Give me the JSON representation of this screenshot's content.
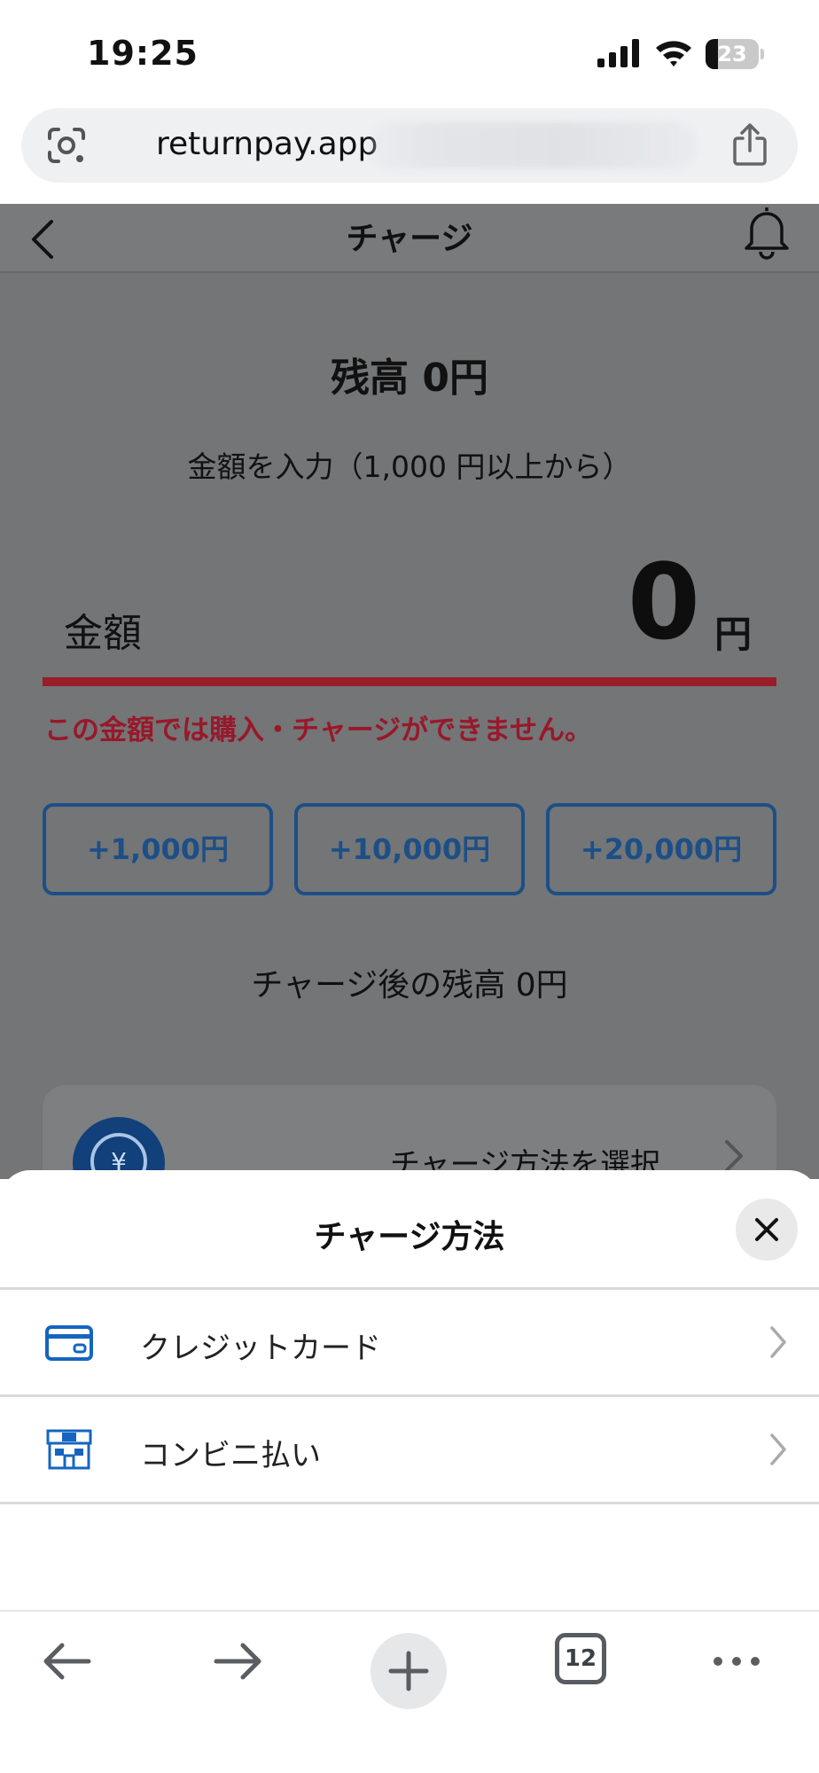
{
  "status_bar": {
    "time": "19:25",
    "battery_percent": 23
  },
  "browser": {
    "url": "returnpay.app"
  },
  "page": {
    "title": "チャージ",
    "balance": "残高 0円",
    "amount_hint": "金額を入力（1,000 円以上から）",
    "amount_label": "金額",
    "amount_value": "0",
    "amount_unit": "円",
    "error": "この金額では購入・チャージができません。",
    "quick_buttons": [
      "+1,000円",
      "+10,000円",
      "+20,000円"
    ],
    "after_balance": "チャージ後の残高 0円",
    "method_select": "チャージ方法を選択"
  },
  "sheet": {
    "title": "チャージ方法",
    "options": [
      {
        "label": "クレジットカード",
        "icon": "credit-card-icon"
      },
      {
        "label": "コンビニ払い",
        "icon": "convenience-store-icon"
      }
    ]
  },
  "toolbar": {
    "tab_count": "12"
  },
  "colors": {
    "error": "#98182a",
    "button_border": "#1d4f86",
    "icon_blue": "#1565c0"
  }
}
